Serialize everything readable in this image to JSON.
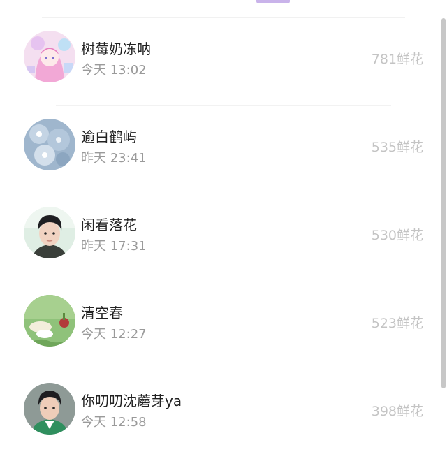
{
  "tab": {
    "active_indicator_color": "#c9b3ea"
  },
  "ranking": {
    "items": [
      {
        "name": "树莓奶冻呐",
        "time": "今天 13:02",
        "flowers": "781鲜花",
        "avatar_icon": "anime-pink-girl-avatar"
      },
      {
        "name": "逾白鹤屿",
        "time": "昨天 23:41",
        "flowers": "535鲜花",
        "avatar_icon": "blue-flower-avatar"
      },
      {
        "name": "闲看落花",
        "time": "昨天 17:31",
        "flowers": "530鲜花",
        "avatar_icon": "young-man-portrait-avatar"
      },
      {
        "name": "清空春",
        "time": "今天 12:27",
        "flowers": "523鲜花",
        "avatar_icon": "green-plant-avatar"
      },
      {
        "name": "你叨叨沈蘑芽ya",
        "time": "今天 12:58",
        "flowers": "398鲜花",
        "avatar_icon": "young-man-green-jacket-avatar"
      }
    ]
  }
}
